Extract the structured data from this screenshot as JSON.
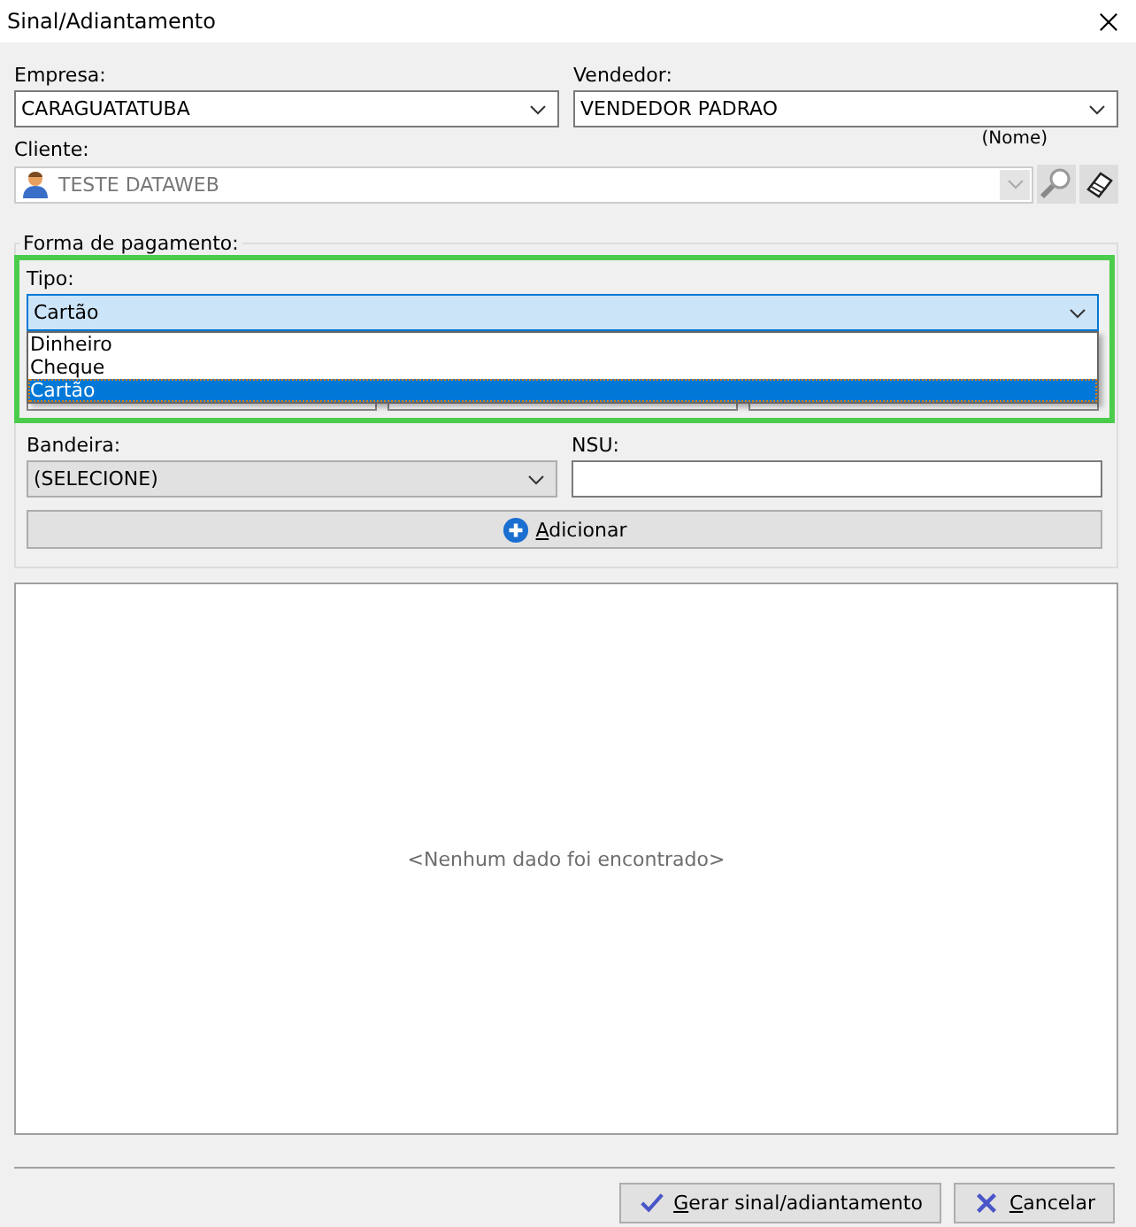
{
  "window": {
    "title": "Sinal/Adiantamento"
  },
  "empresa": {
    "label": "Empresa:",
    "value": "CARAGUATATUBA"
  },
  "vendedor": {
    "label": "Vendedor:",
    "value": "VENDEDOR PADRAO"
  },
  "cliente": {
    "label": "Cliente:",
    "value": "TESTE DATAWEB",
    "search_mode": "(Nome)",
    "disabled": true
  },
  "payment": {
    "title": "Forma de pagamento:",
    "tipo": {
      "label": "Tipo:",
      "value": "Cartão",
      "expanded": true,
      "options": [
        {
          "label": "Dinheiro",
          "selected": false
        },
        {
          "label": "Cheque",
          "selected": false
        },
        {
          "label": "Cartão",
          "selected": true
        }
      ]
    },
    "bandeira": {
      "label": "Bandeira:",
      "value": "(SELECIONE)"
    },
    "nsu": {
      "label": "NSU:"
    },
    "add_button": "Adicionar"
  },
  "grid": {
    "empty_message": "<Nenhum dado foi encontrado>"
  },
  "buttons": [
    {
      "kind": "confirm",
      "label": "Gerar sinal/adiantamento"
    },
    {
      "kind": "cancel",
      "label": "Cancelar"
    }
  ]
}
